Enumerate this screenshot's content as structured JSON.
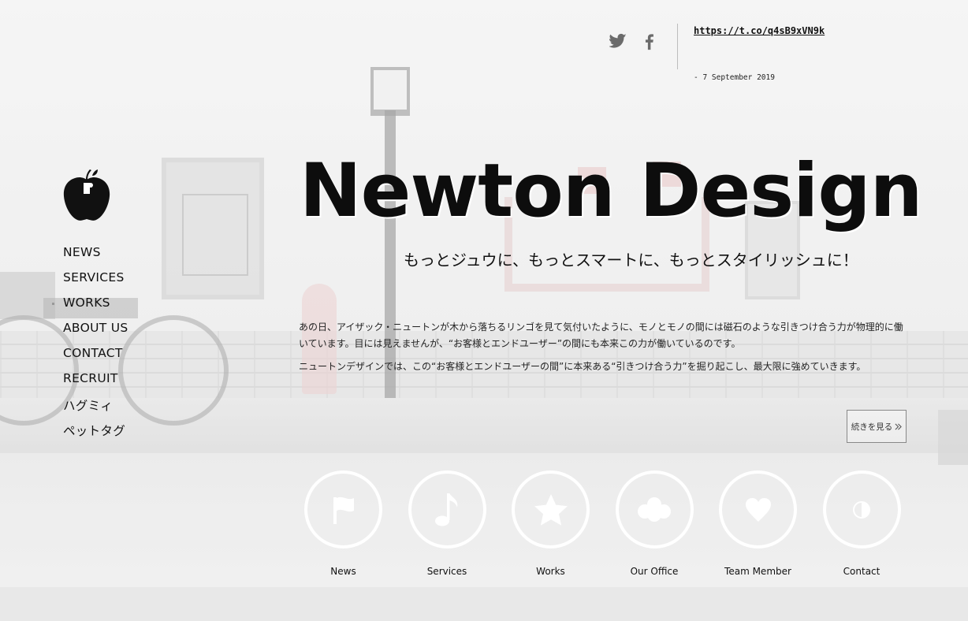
{
  "social": {
    "twitter_icon": "twitter-icon",
    "facebook_icon": "facebook-icon",
    "tweet_link": "https://t.co/q4sB9xVN9k",
    "tweet_date": "- 7 September 2019"
  },
  "sidebar": {
    "logo": "apple-logo",
    "items": [
      {
        "label": "NEWS"
      },
      {
        "label": "SERVICES"
      },
      {
        "label": "WORKS"
      },
      {
        "label": "ABOUT US"
      },
      {
        "label": "CONTACT"
      },
      {
        "label": "RECRUIT"
      },
      {
        "label": "ハグミィ"
      },
      {
        "label": "ペットタグ"
      }
    ]
  },
  "hero": {
    "title": "Newton Design",
    "subtitle": "もっとジュウに、もっとスマートに、もっとスタイリッシュに！",
    "paragraph1": "あの日、アイザック・ニュートンが木から落ちるリンゴを見て気付いたように、モノとモノの間には磁石のような引きつけ合う力が物理的に働いています。目には見えませんが、“お客様とエンドユーザー”の間にも本来この力が働いているのです。",
    "paragraph2": "ニュートンデザインでは、この“お客様とエンドユーザーの間”に本来ある“引きつけ合う力”を掘り起こし、最大限に強めていきます。",
    "more_label": "続きを見る",
    "more_icon": "double-chevron-right-icon"
  },
  "circle_menu": [
    {
      "label": "News",
      "icon": "flag-icon"
    },
    {
      "label": "Services",
      "icon": "music-note-icon"
    },
    {
      "label": "Works",
      "icon": "star-icon"
    },
    {
      "label": "Our Office",
      "icon": "cloud-icon"
    },
    {
      "label": "Team Member",
      "icon": "heart-icon"
    },
    {
      "label": "Contact",
      "icon": "half-circle-icon"
    }
  ]
}
